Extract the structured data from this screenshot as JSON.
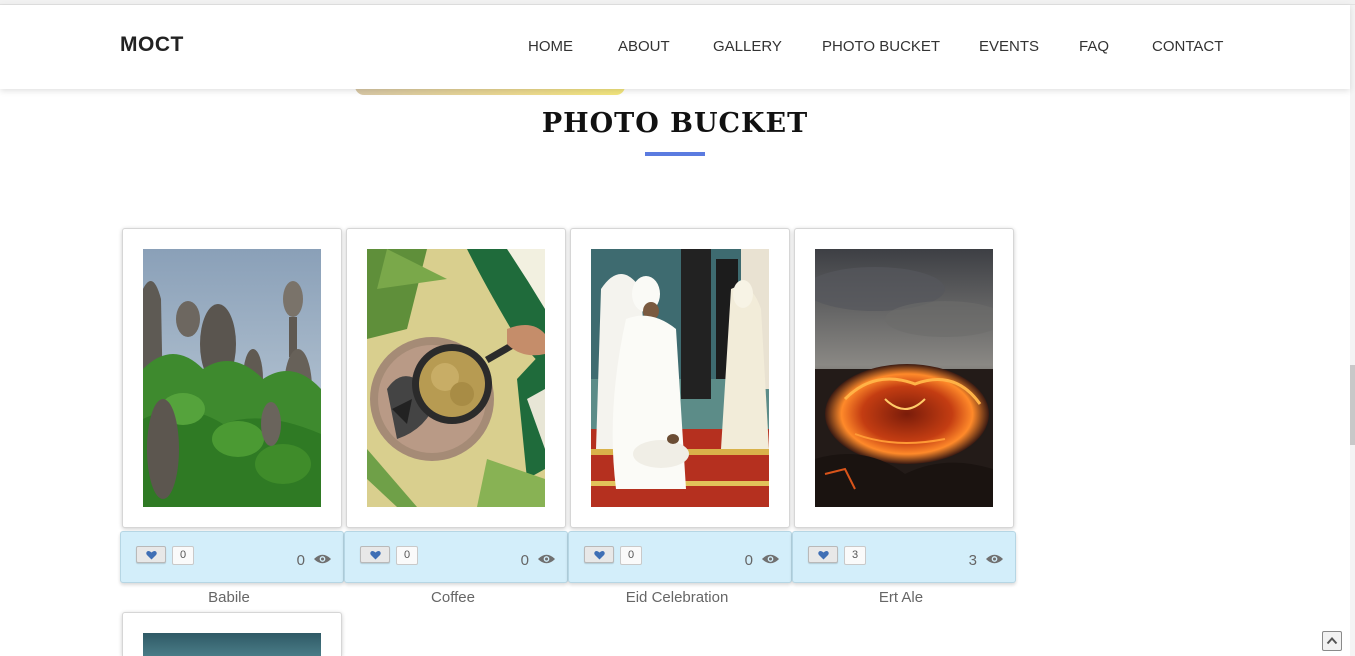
{
  "brand": "MOCT",
  "nav": [
    {
      "label": "HOME"
    },
    {
      "label": "ABOUT"
    },
    {
      "label": "GALLERY"
    },
    {
      "label": "PHOTO BUCKET"
    },
    {
      "label": "EVENTS"
    },
    {
      "label": "FAQ"
    },
    {
      "label": "CONTACT"
    }
  ],
  "section_title": "PHOTO BUCKET",
  "accent_color": "#5b7be0",
  "stats_bar_color": "#d3eefa",
  "photos": [
    {
      "caption": "Babile",
      "likes": "0",
      "views": "0",
      "image": "babile-rocks-photo"
    },
    {
      "caption": "Coffee",
      "likes": "0",
      "views": "0",
      "image": "coffee-roasting-photo"
    },
    {
      "caption": "Eid Celebration",
      "likes": "0",
      "views": "0",
      "image": "eid-celebration-photo"
    },
    {
      "caption": "Ert Ale",
      "likes": "3",
      "views": "3",
      "image": "ert-ale-lava-photo"
    }
  ],
  "icons": {
    "like": "heart-icon",
    "views": "eye-icon",
    "scroll_top": "chevron-up-icon"
  }
}
